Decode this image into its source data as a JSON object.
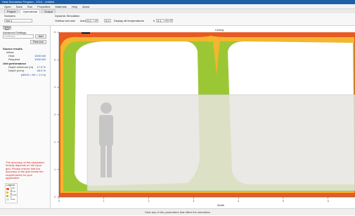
{
  "window": {
    "title": "Heat Simulation Program - 2014 - Untitled"
  },
  "menu": {
    "items": [
      "Open",
      "Save",
      "Run",
      "Properties",
      "Materials",
      "Help",
      "About"
    ]
  },
  "tabs": [
    "Project",
    "Operational",
    "Output"
  ],
  "toolbar": {
    "group1_label": "Scenario",
    "group1_value": "Set 1",
    "group2_label": "Dynamic Simulation",
    "row_label": "Outflow slot size",
    "field_a_label": "Area",
    "field_a_value": "0.0",
    "field_b_value": "0.0",
    "field_c_label": "Display all temperatures",
    "field_d_value": "0.1"
  },
  "sidebar": {
    "tab_button": "Setup Run",
    "settings_title": "Advanced Settings",
    "input_placeholder": "Outflows",
    "add_button": "Add",
    "remove_button": "Remove",
    "section_inputs": "Source results",
    "inputs": [
      {
        "label": "Inflow",
        "value": ""
      },
      {
        "label": "Heat",
        "value": "1000 kW"
      },
      {
        "label": "Required",
        "value": "1000 kW"
      }
    ],
    "section_perf": "Unit performance",
    "perf": [
      {
        "label": "Depth minimum (m)",
        "value": "17.5 %"
      },
      {
        "label": "Depth (m/m)",
        "value": "46.0 %"
      },
      {
        "label": "",
        "value": "(dH/dt = dH = 1.0 s)"
      }
    ],
    "warning": "The accuracy of this simulation heavily depends on the input grid. Please ensure that the accuracy of the grid meets the requirements for your application.",
    "legend_title": "Legend",
    "legend": [
      {
        "label": "0-40 %",
        "color": "#f0602a"
      },
      {
        "label": "40-70 %",
        "color": "#f5b330"
      },
      {
        "label": "70-100 %",
        "color": "#9cc734"
      },
      {
        "label": "Heat",
        "color": "#d9d9d9"
      }
    ]
  },
  "plot": {
    "top_label": "Ceiling",
    "x_axis_label": "Width",
    "x_ticks": [
      "0",
      "1",
      "2",
      "3",
      "4",
      "5",
      "6"
    ],
    "y_ticks": [
      "0",
      "1",
      "2",
      "3",
      "4",
      "5",
      "6"
    ],
    "colors": {
      "red": "#e85a24",
      "orange": "#f5b52e",
      "green": "#9cc734",
      "occupant": "#c4c4c4",
      "room": "#e7e5e1"
    }
  },
  "status": {
    "text": "View any of the parameters that affect the simulation"
  }
}
